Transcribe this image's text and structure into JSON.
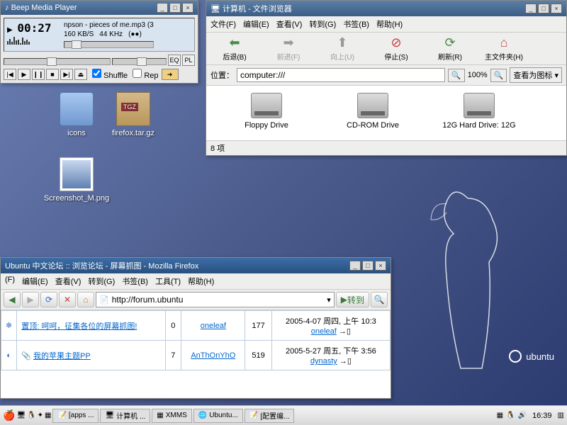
{
  "beep": {
    "title": "Beep Media Player",
    "time": "00:27",
    "track": "npson - pieces of me.mp3 (3",
    "bitrate": "160 KB/S",
    "freq": "44 KHz",
    "stereo": "(●●)",
    "eq": "EQ",
    "pl": "PL",
    "shuffle": "Shuffle",
    "repeat": "Rep"
  },
  "fb": {
    "title": "计算机 - 文件浏览器",
    "menu": [
      "文件(F)",
      "编辑(E)",
      "查看(V)",
      "转到(G)",
      "书签(B)",
      "帮助(H)"
    ],
    "tb": {
      "back": "后退(B)",
      "fwd": "前进(F)",
      "up": "向上(U)",
      "stop": "停止(S)",
      "reload": "刷新(R)",
      "home": "主文件夹(H)"
    },
    "loc_label": "位置：",
    "loc": "computer:///",
    "zoom": "100%",
    "viewas": "查看为图标",
    "drives": [
      "Floppy Drive",
      "CD-ROM Drive",
      "12G Hard Drive: 12G"
    ],
    "status": "8 项"
  },
  "desk": {
    "icons": "icons",
    "archive": "firefox.tar.gz",
    "shot": "Screenshot_M.png"
  },
  "ff": {
    "title": "Ubuntu 中文论坛  ::  浏览论坛  -  屏幕抓图  -  Mozilla Firefox",
    "menu": [
      "(F)",
      "编辑(E)",
      "查看(V)",
      "转到(G)",
      "书签(B)",
      "工具(T)",
      "帮助(H)"
    ],
    "url": "http://forum.ubuntu",
    "go": "转到",
    "rows": [
      {
        "topic": "置顶: 呵呵，征集各位的屏幕抓图!",
        "replies": "0",
        "author": "oneleaf",
        "views": "177",
        "last": "2005-4-07 周四, 上午 10:3",
        "lastby": "oneleaf"
      },
      {
        "topic": "我的苹果主题PP",
        "replies": "7",
        "author": "AnThOnYhO",
        "views": "519",
        "last": "2005-5-27 周五, 下午 3:56",
        "lastby": "dynasty"
      }
    ]
  },
  "tasks": [
    "[apps ...",
    "计算机 ...",
    "XMMS",
    "Ubuntu...",
    "[配置编..."
  ],
  "ubuntu": "ubuntu",
  "clock": "16:39"
}
